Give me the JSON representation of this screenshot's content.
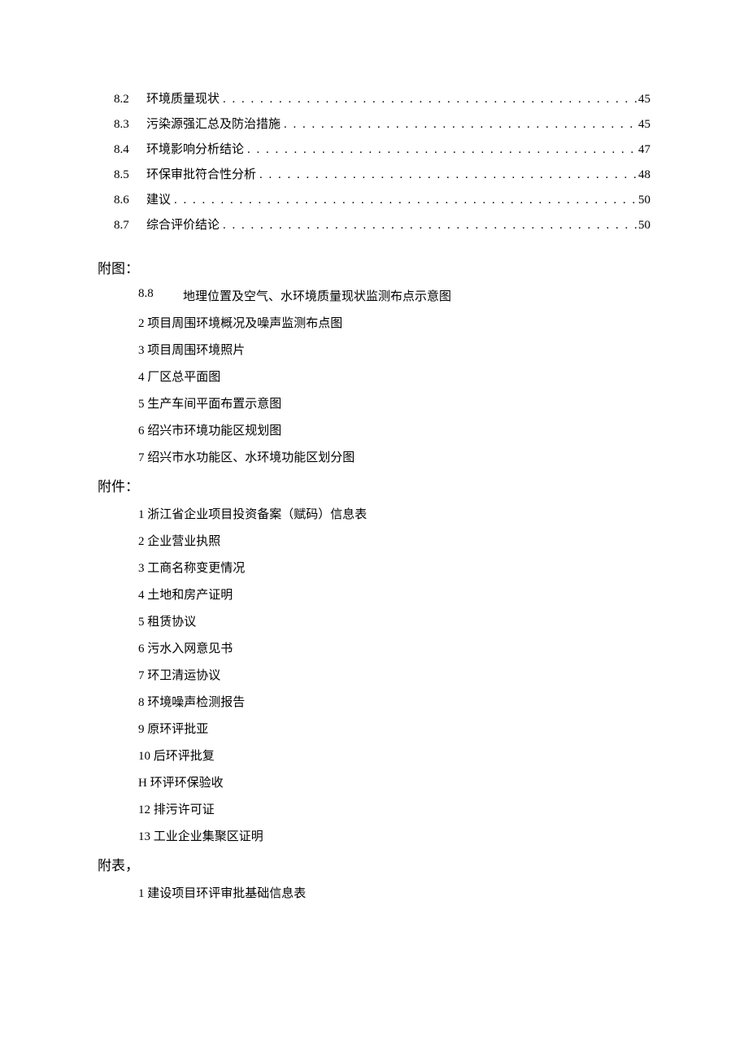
{
  "toc": [
    {
      "num": "8.2",
      "title": "环境质量现状",
      "page": "45"
    },
    {
      "num": "8.3",
      "title": "污染源强汇总及防治措施",
      "page": "45"
    },
    {
      "num": "8.4",
      "title": "环境影响分析结论",
      "page": "47"
    },
    {
      "num": "8.5",
      "title": "环保审批符合性分析",
      "page": "48"
    },
    {
      "num": "8.6",
      "title": "建议",
      "page": "50"
    },
    {
      "num": "8.7",
      "title": "综合评价结论",
      "page": "50"
    }
  ],
  "sections": {
    "futu": {
      "head": "附图：",
      "first": {
        "num": "8.8",
        "text": "地理位置及空气、水环境质量现状监测布点示意图"
      },
      "items": [
        "2 项目周围环境概况及噪声监测布点图",
        "3 项目周围环境照片",
        "4 厂区总平面图",
        "5 生产车间平面布置示意图",
        "6 绍兴市环境功能区规划图",
        "7 绍兴市水功能区、水环境功能区划分图"
      ]
    },
    "fujian": {
      "head": "附件：",
      "items": [
        "1 浙江省企业项目投资备案（赋码）信息表",
        "2 企业营业执照",
        "3 工商名称变更情况",
        "4 土地和房产证明",
        "5 租赁协议",
        "6 污水入网意见书",
        "7 环卫清运协议",
        "8 环境噪声检测报告",
        "9 原环评批亚",
        "10 后环评批复",
        "H 环评环保验收",
        "12 排污许可证",
        "13 工业企业集聚区证明"
      ]
    },
    "fubiao": {
      "head": "附表，",
      "items": [
        "1 建设项目环评审批基础信息表"
      ]
    }
  },
  "dots": ". . . . . . . . . . . . . . . . . . . . . . . . . . . . . . . . . . . . . . . . . . . . . . . . . . . . . . . . . . . . . . . . . . . . . . . . . . . . . . . . . . . . . . . . . . . ."
}
